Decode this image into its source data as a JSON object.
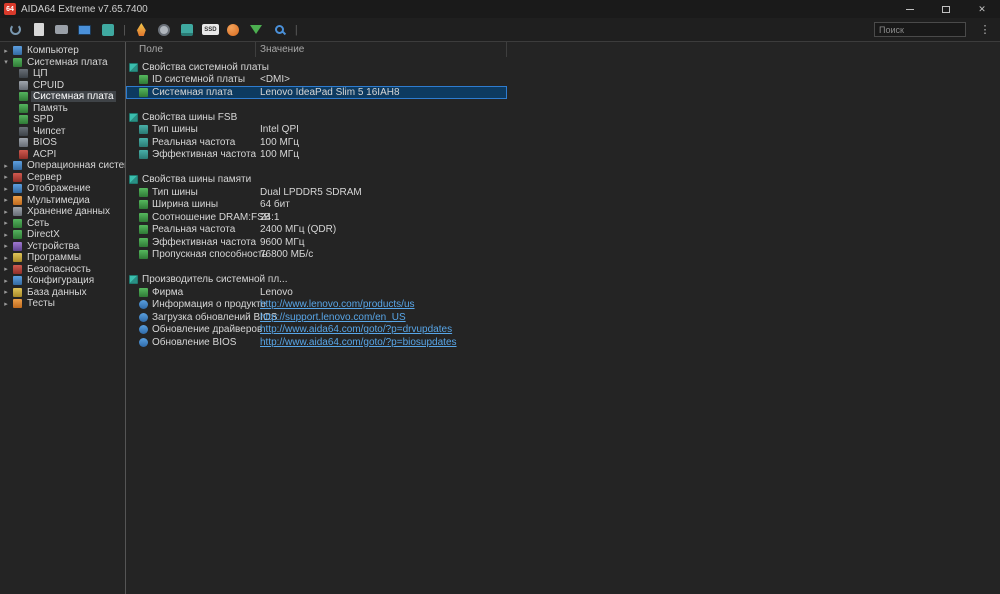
{
  "window": {
    "logo_text": "64",
    "title": "AIDA64 Extreme v7.65.7400"
  },
  "toolbar": {
    "search_placeholder": "Поиск",
    "ssd_badge_label": "SSD",
    "icons": [
      "refresh",
      "report",
      "drive",
      "display",
      "sensors",
      "stability-test",
      "disk-benchmark",
      "cache-benchmark",
      "ssd-benchmark",
      "monitor-diagnostics",
      "update",
      "search-tool"
    ]
  },
  "sidebar": {
    "items": [
      {
        "label": "Компьютер",
        "level": 0,
        "expanded": false
      },
      {
        "label": "Системная плата",
        "level": 0,
        "expanded": true
      },
      {
        "label": "ЦП",
        "level": 1
      },
      {
        "label": "CPUID",
        "level": 1
      },
      {
        "label": "Системная плата",
        "level": 1,
        "selected": true
      },
      {
        "label": "Память",
        "level": 1
      },
      {
        "label": "SPD",
        "level": 1
      },
      {
        "label": "Чипсет",
        "level": 1
      },
      {
        "label": "BIOS",
        "level": 1
      },
      {
        "label": "ACPI",
        "level": 1
      },
      {
        "label": "Операционная система",
        "level": 0,
        "expanded": false
      },
      {
        "label": "Сервер",
        "level": 0,
        "expanded": false
      },
      {
        "label": "Отображение",
        "level": 0,
        "expanded": false
      },
      {
        "label": "Мультимедиа",
        "level": 0,
        "expanded": false
      },
      {
        "label": "Хранение данных",
        "level": 0,
        "expanded": false
      },
      {
        "label": "Сеть",
        "level": 0,
        "expanded": false
      },
      {
        "label": "DirectX",
        "level": 0,
        "expanded": false
      },
      {
        "label": "Устройства",
        "level": 0,
        "expanded": false
      },
      {
        "label": "Программы",
        "level": 0,
        "expanded": false
      },
      {
        "label": "Безопасность",
        "level": 0,
        "expanded": false
      },
      {
        "label": "Конфигурация",
        "level": 0,
        "expanded": false
      },
      {
        "label": "База данных",
        "level": 0,
        "expanded": false
      },
      {
        "label": "Тесты",
        "level": 0,
        "expanded": false
      }
    ]
  },
  "table": {
    "columns": [
      "Поле",
      "Значение"
    ],
    "rows": [
      {
        "type": "section",
        "field": "Свойства системной платы"
      },
      {
        "type": "item",
        "field": "ID системной платы",
        "value": "<DMI>"
      },
      {
        "type": "item",
        "field": "Системная плата",
        "value": "Lenovo IdeaPad Slim 5 16IAH8",
        "selected": true
      },
      {
        "type": "spacer"
      },
      {
        "type": "section",
        "field": "Свойства шины FSB"
      },
      {
        "type": "item",
        "field": "Тип шины",
        "value": "Intel QPI"
      },
      {
        "type": "item",
        "field": "Реальная частота",
        "value": "100 МГц"
      },
      {
        "type": "item",
        "field": "Эффективная частота",
        "value": "100 МГц"
      },
      {
        "type": "spacer"
      },
      {
        "type": "section",
        "field": "Свойства шины памяти"
      },
      {
        "type": "item",
        "field": "Тип шины",
        "value": "Dual LPDDR5 SDRAM"
      },
      {
        "type": "item",
        "field": "Ширина шины",
        "value": "64 бит"
      },
      {
        "type": "item",
        "field": "Соотношение DRAM:FSB",
        "value": "24:1"
      },
      {
        "type": "item",
        "field": "Реальная частота",
        "value": "2400 МГц (QDR)"
      },
      {
        "type": "item",
        "field": "Эффективная частота",
        "value": "9600 МГц"
      },
      {
        "type": "item",
        "field": "Пропускная способность",
        "value": "76800 МБ/с"
      },
      {
        "type": "spacer"
      },
      {
        "type": "section",
        "field": "Производитель системной пл..."
      },
      {
        "type": "item",
        "field": "Фирма",
        "value": "Lenovo"
      },
      {
        "type": "link",
        "field": "Информация о продукте",
        "value": "http://www.lenovo.com/products/us"
      },
      {
        "type": "link",
        "field": "Загрузка обновлений BIOS",
        "value": "http://support.lenovo.com/en_US"
      },
      {
        "type": "link",
        "field": "Обновление драйверов",
        "value": "http://www.aida64.com/goto/?p=drvupdates"
      },
      {
        "type": "link",
        "field": "Обновление BIOS",
        "value": "http://www.aida64.com/goto/?p=biosupdates"
      }
    ]
  },
  "colors": {
    "selection_background": "#0d3a60",
    "selection_border": "#2e7cd0",
    "link": "#58a6e8",
    "logo_red": "#d93a2b"
  }
}
